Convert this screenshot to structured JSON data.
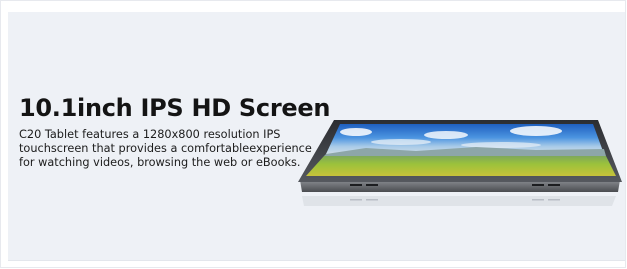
{
  "banner": {
    "headline": "10.1inch IPS HD Screen",
    "description": "C20 Tablet features a 1280x800 resolution IPS touchscreen that provides a comfortableexperience for watching videos, browsing the web or eBooks."
  },
  "colors": {
    "background": "#eef1f6",
    "headline": "#141414",
    "body_text": "#1c1c1c",
    "tablet_body": "#3b3d42",
    "screen_sky": "#2f78d4",
    "screen_grass": "#86b53a"
  }
}
